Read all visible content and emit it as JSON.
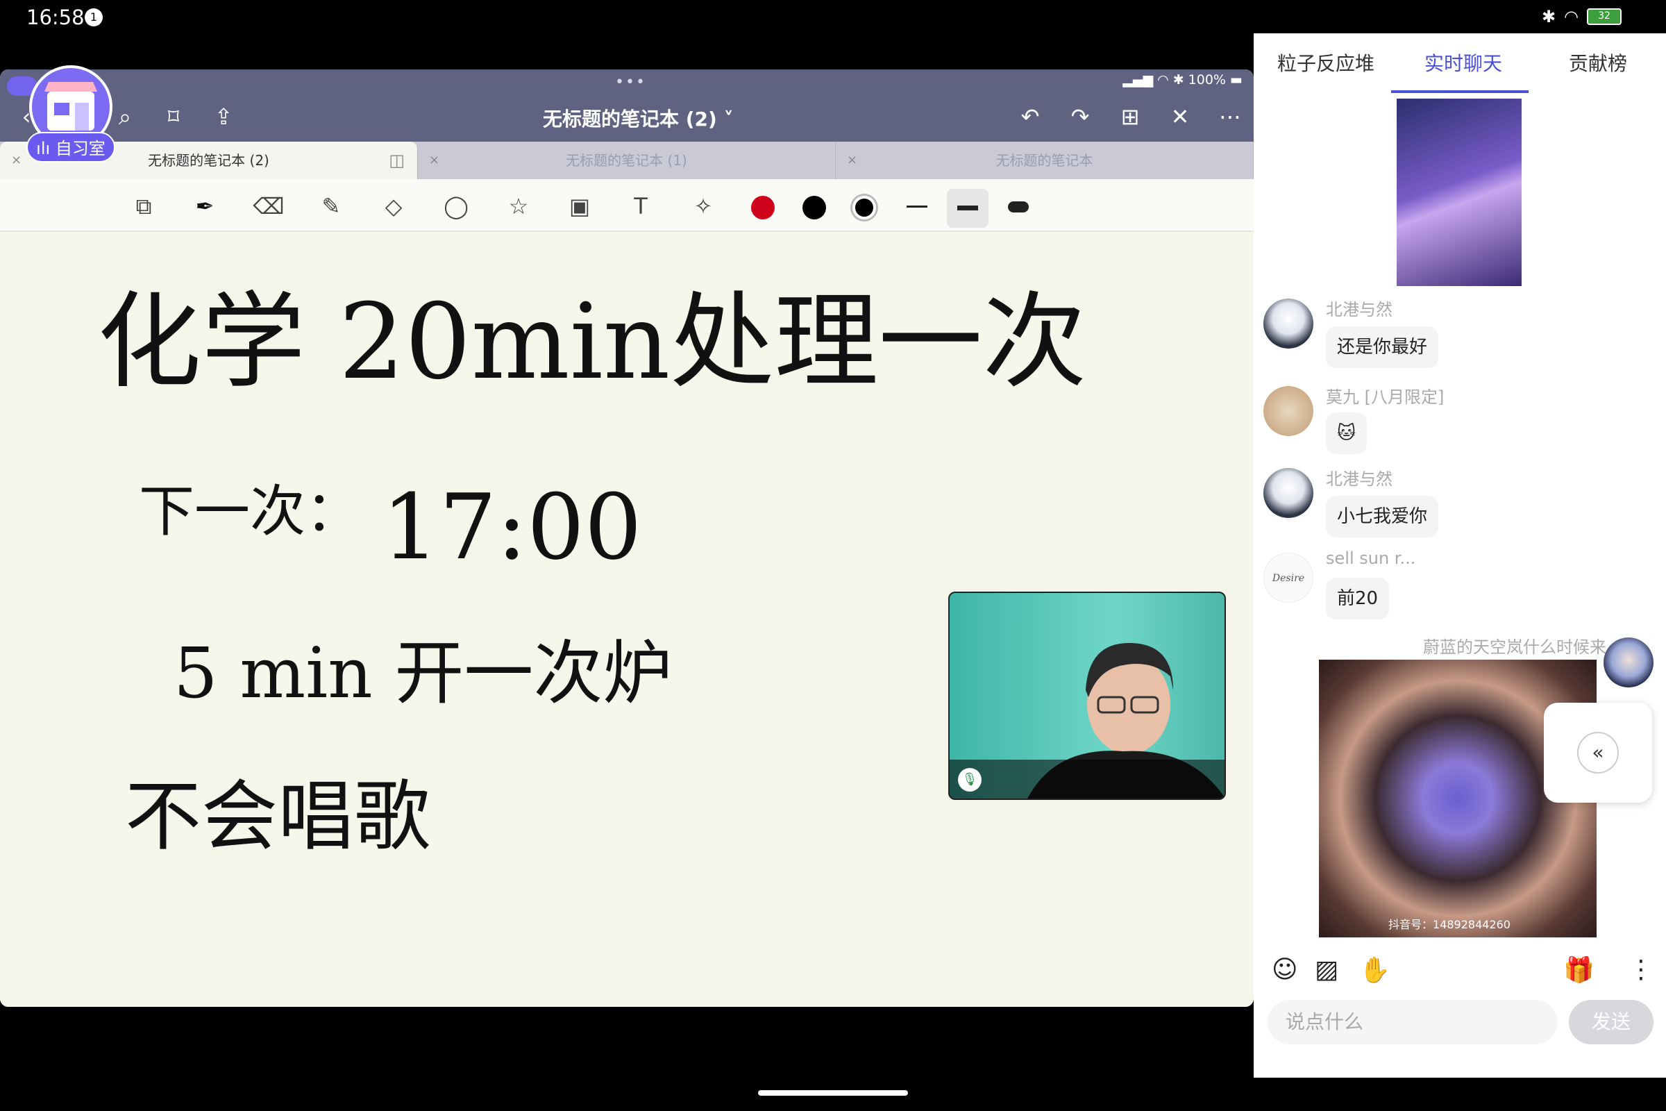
{
  "status_bar": {
    "time": "16:58",
    "notification_count": "1",
    "battery": "32"
  },
  "notes_app": {
    "device_status": "100%",
    "title": "无标题的笔记本 (2)",
    "tabs": [
      {
        "label": "无标题的笔记本 (2)"
      },
      {
        "label": "无标题的笔记本 (1)"
      },
      {
        "label": "无标题的笔记本"
      }
    ],
    "handwriting": [
      "化学  20min处理一次",
      "下一次：",
      "17:00",
      "5 min 开一次炉",
      "不会唱歌"
    ],
    "pen_colors": [
      "#d0021b",
      "#000000",
      "#000000"
    ]
  },
  "study_room_badge": {
    "label": "自习室"
  },
  "chat_panel": {
    "tabs": [
      {
        "label": "粒子反应堆"
      },
      {
        "label": "实时聊天"
      },
      {
        "label": "贡献榜"
      }
    ],
    "messages": [
      {
        "user": "北港与然",
        "text": "还是你最好"
      },
      {
        "user": "莫九 [八月限定]",
        "text": "🐱"
      },
      {
        "user": "北港与然",
        "text": "小七我爱你"
      },
      {
        "user": "sell sun r...",
        "text": "前20"
      },
      {
        "user": "蔚蓝的天空岚什么时候来",
        "text": ""
      }
    ],
    "image_watermark": "抖音号：14892844260",
    "input_placeholder": "说点什么",
    "send_label": "发送"
  },
  "colors": {
    "accent": "#4a50d8",
    "header": "#5f6381",
    "badge": "#6a5af0"
  }
}
